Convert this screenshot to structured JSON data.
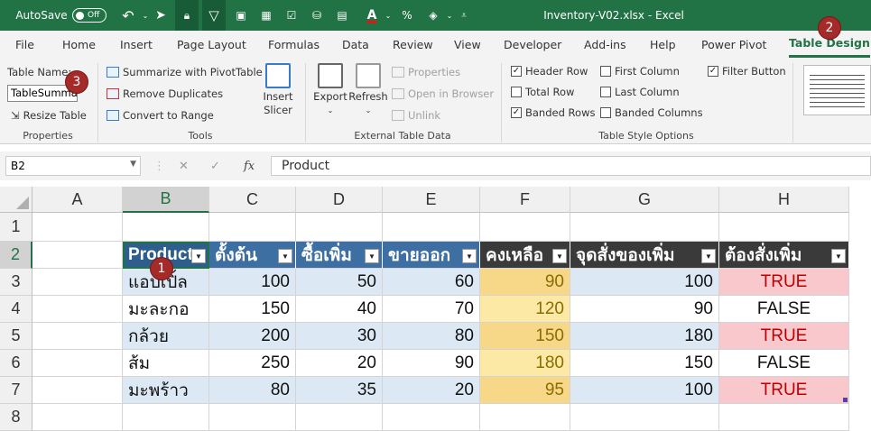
{
  "title_bar": {
    "autosave_label": "AutoSave",
    "autosave_state": "Off",
    "document_title": "Inventory-V02.xlsx  -  Excel"
  },
  "tabs": [
    "File",
    "Home",
    "Insert",
    "Page Layout",
    "Formulas",
    "Data",
    "Review",
    "View",
    "Developer",
    "Add-ins",
    "Help",
    "Power Pivot",
    "Table Design"
  ],
  "active_tab": "Table Design",
  "ribbon": {
    "properties": {
      "table_name_label": "Table Name:",
      "table_name_value": "TableSummary",
      "resize_label": "Resize Table",
      "group_label": "Properties"
    },
    "tools": {
      "summarize": "Summarize with PivotTable",
      "remove_dupes": "Remove Duplicates",
      "convert": "Convert to Range",
      "insert_slicer_1": "Insert",
      "insert_slicer_2": "Slicer",
      "group_label": "Tools"
    },
    "external": {
      "export": "Export",
      "refresh": "Refresh",
      "properties": "Properties",
      "open_browser": "Open in Browser",
      "unlink": "Unlink",
      "group_label": "External Table Data"
    },
    "style_options": {
      "header_row": "Header Row",
      "total_row": "Total Row",
      "banded_rows": "Banded Rows",
      "first_column": "First Column",
      "last_column": "Last Column",
      "banded_columns": "Banded Columns",
      "filter_button": "Filter Button",
      "group_label": "Table Style Options",
      "checked": {
        "header_row": true,
        "total_row": false,
        "banded_rows": true,
        "first_column": false,
        "last_column": false,
        "banded_columns": false,
        "filter_button": true
      }
    }
  },
  "formula_bar": {
    "name_box": "B2",
    "fx": "fx",
    "value": "Product"
  },
  "grid": {
    "columns": [
      "A",
      "B",
      "C",
      "D",
      "E",
      "F",
      "G",
      "H"
    ],
    "rows": [
      "1",
      "2",
      "3",
      "4",
      "5",
      "6",
      "7",
      "8"
    ],
    "headers": [
      "Product",
      "ตั้งต้น",
      "ซื้อเพิ่ม",
      "ขายออก",
      "คงเหลือ",
      "จุดสั่งของเพิ่ม",
      "ต้องสั่งเพิ่ม"
    ],
    "data": [
      [
        "แอปเปิ้ล",
        "100",
        "50",
        "60",
        "90",
        "100",
        "TRUE"
      ],
      [
        "มะละกอ",
        "150",
        "40",
        "70",
        "120",
        "90",
        "FALSE"
      ],
      [
        "กล้วย",
        "200",
        "30",
        "80",
        "150",
        "180",
        "TRUE"
      ],
      [
        "ส้ม",
        "250",
        "20",
        "90",
        "180",
        "150",
        "FALSE"
      ],
      [
        "มะพร้าว",
        "80",
        "35",
        "20",
        "95",
        "100",
        "TRUE"
      ]
    ]
  },
  "annotations": [
    "1",
    "2",
    "3"
  ],
  "colors": {
    "excel_green": "#217346",
    "header_dark": "#3a3a3a",
    "band_blue": "#dce9f5",
    "yellow_fill": "#fde9a6",
    "yellow_band": "#f7d889",
    "pink_fill": "#f8c8cd",
    "true_text": "#c00000"
  }
}
